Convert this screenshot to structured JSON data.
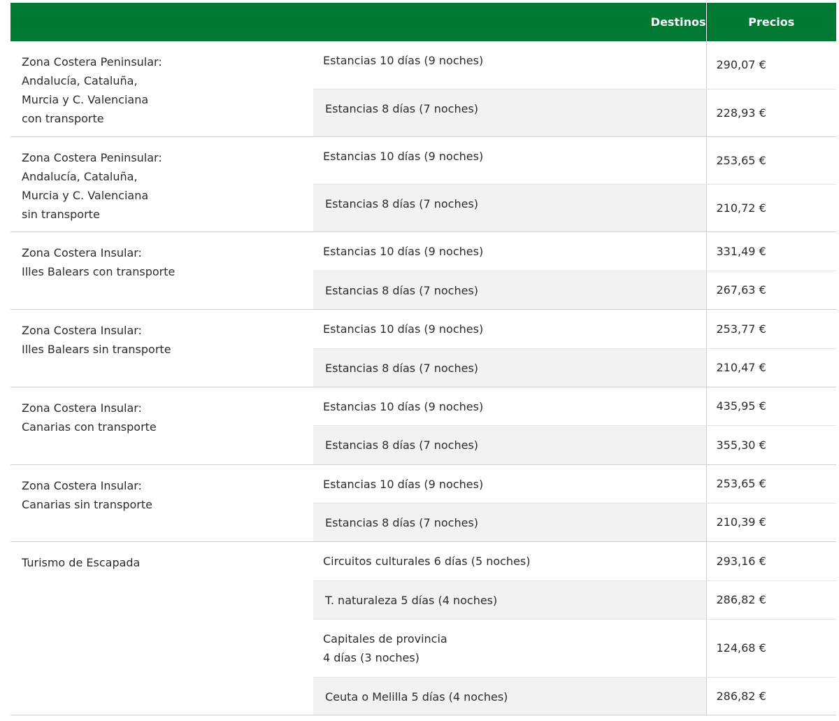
{
  "header": {
    "destinos": "Destinos",
    "precios": "Precios"
  },
  "groups": [
    {
      "zone": "Zona Costera Peninsular:\nAndalucía, Cataluña,\nMurcia y C. Valenciana\ncon transporte",
      "rows": [
        {
          "stay": "Estancias 10 días (9 noches)",
          "price": "290,07 €"
        },
        {
          "stay": "Estancias 8 días (7 noches)",
          "price": "228,93 €"
        }
      ]
    },
    {
      "zone": "Zona Costera Peninsular:\nAndalucía, Cataluña,\nMurcia y C. Valenciana\nsin transporte",
      "rows": [
        {
          "stay": "Estancias 10 días (9 noches)",
          "price": "253,65 €"
        },
        {
          "stay": "Estancias 8 días (7 noches)",
          "price": "210,72 €"
        }
      ]
    },
    {
      "zone": "Zona Costera Insular:\nIlles Balears con transporte",
      "rows": [
        {
          "stay": "Estancias 10 días (9 noches)",
          "price": "331,49 €"
        },
        {
          "stay": "Estancias 8 días (7 noches)",
          "price": "267,63 €"
        }
      ]
    },
    {
      "zone": "Zona Costera Insular:\nIlles Balears sin transporte",
      "rows": [
        {
          "stay": "Estancias 10 días (9 noches)",
          "price": "253,77 €"
        },
        {
          "stay": "Estancias 8 días (7 noches)",
          "price": "210,47 €"
        }
      ]
    },
    {
      "zone": "Zona Costera Insular:\nCanarias con transporte",
      "rows": [
        {
          "stay": "Estancias 10 días (9 noches)",
          "price": "435,95 €"
        },
        {
          "stay": "Estancias 8 días (7 noches)",
          "price": "355,30 €"
        }
      ]
    },
    {
      "zone": "Zona Costera Insular:\nCanarias sin transporte",
      "rows": [
        {
          "stay": "Estancias 10 días (9 noches)",
          "price": "253,65 €"
        },
        {
          "stay": "Estancias 8 días (7 noches)",
          "price": "210,39 €"
        }
      ]
    },
    {
      "zone": "Turismo de Escapada",
      "rows": [
        {
          "stay": "Circuitos culturales 6 días (5 noches)",
          "price": "293,16 €"
        },
        {
          "stay": "T. naturaleza 5 días (4 noches)",
          "price": "286,82 €"
        },
        {
          "stay": "Capitales de provincia\n4 días (3 noches)",
          "price": "124,68 €"
        },
        {
          "stay": "Ceuta o Melilla 5 días (4 noches)",
          "price": "286,82 €"
        }
      ]
    }
  ],
  "colors": {
    "header_bg": "#007a33",
    "alt_row_bg": "#f2f2f2"
  }
}
